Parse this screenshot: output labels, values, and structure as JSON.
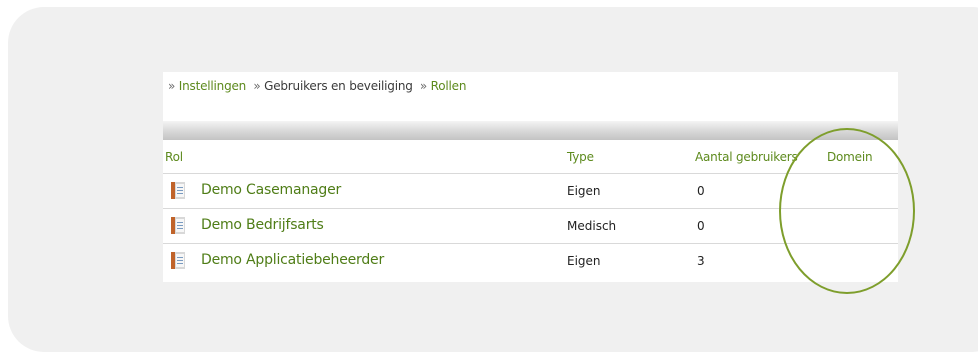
{
  "breadcrumb": {
    "items": [
      {
        "sep": "»",
        "label": "Instellingen"
      },
      {
        "sep": "»",
        "label": "Gebruikers en beveiliging"
      },
      {
        "sep": "»",
        "label": "Rollen"
      }
    ]
  },
  "table": {
    "columns": {
      "rol": "Rol",
      "type": "Type",
      "aantal": "Aantal gebruikers",
      "domein": "Domein"
    },
    "rows": [
      {
        "icon": "role-book-icon",
        "name": "Demo Casemanager",
        "type": "Eigen",
        "aantal": "0",
        "domein": ""
      },
      {
        "icon": "role-book-icon",
        "name": "Demo Bedrijfsarts",
        "type": "Medisch",
        "aantal": "0",
        "domein": ""
      },
      {
        "icon": "role-book-icon",
        "name": "Demo Applicatiebeheerder",
        "type": "Eigen",
        "aantal": "3",
        "domein": ""
      }
    ]
  },
  "colors": {
    "link": "#5d8a1d",
    "highlight_circle": "#7e9e2c",
    "backdrop": "#f0f0f0"
  }
}
